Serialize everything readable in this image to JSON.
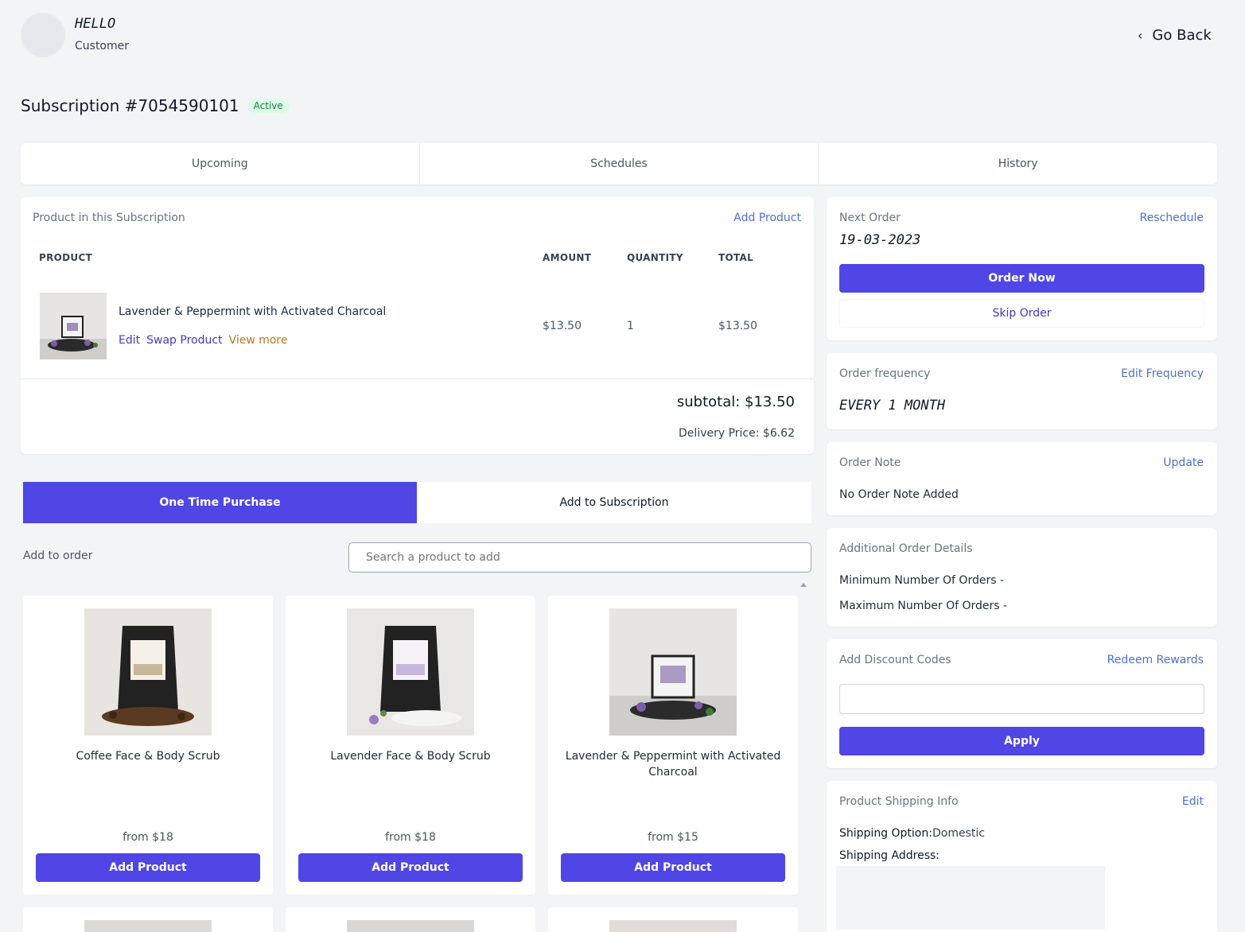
{
  "header": {
    "greeting": "HELLO",
    "user_role": "Customer",
    "go_back_label": "Go Back"
  },
  "subscription": {
    "title": "Subscription #7054590101",
    "status": "Active"
  },
  "tabs": [
    {
      "label": "Upcoming"
    },
    {
      "label": "Schedules"
    },
    {
      "label": "History"
    }
  ],
  "products_panel": {
    "title": "Product in this Subscription",
    "add_product_link": "Add Product",
    "columns": {
      "product": "PRODUCT",
      "amount": "AMOUNT",
      "quantity": "QUANTITY",
      "total": "TOTAL"
    },
    "item": {
      "name": "Lavender & Peppermint with Activated Charcoal",
      "edit": "Edit",
      "swap": "Swap Product",
      "view_more": "View more",
      "amount": "$13.50",
      "quantity": "1",
      "total": "$13.50"
    },
    "subtotal": "subtotal: $13.50",
    "delivery": "Delivery Price: $6.62"
  },
  "purchase_toggle": {
    "one_time": "One Time Purchase",
    "add_to_sub": "Add to Subscription"
  },
  "add_to_order": {
    "label": "Add to order",
    "search_placeholder": "Search a product to add"
  },
  "catalog": [
    {
      "name": "Coffee Face & Body Scrub",
      "price": "from $18",
      "button": "Add Product"
    },
    {
      "name": "Lavender Face & Body Scrub",
      "price": "from $18",
      "button": "Add Product"
    },
    {
      "name": "Lavender & Peppermint with Activated Charcoal",
      "price": "from $15",
      "button": "Add Product"
    }
  ],
  "next_order": {
    "label": "Next Order",
    "reschedule": "Reschedule",
    "date": "19-03-2023",
    "order_now": "Order Now",
    "skip": "Skip Order"
  },
  "frequency": {
    "label": "Order frequency",
    "edit": "Edit Frequency",
    "value": "EVERY 1 MONTH"
  },
  "order_note": {
    "label": "Order Note",
    "update": "Update",
    "value": "No Order Note Added"
  },
  "additional": {
    "label": "Additional Order Details",
    "min": "Minimum Number Of Orders -",
    "max": "Maximum Number Of Orders -"
  },
  "discount": {
    "label": "Add Discount Codes",
    "redeem": "Redeem Rewards",
    "apply": "Apply"
  },
  "shipping": {
    "label": "Product Shipping Info",
    "edit": "Edit",
    "option_label": "Shipping Option:",
    "option_value": "Domestic",
    "address_label": "Shipping Address:"
  },
  "colors": {
    "primary": "#4f46e5",
    "link": "#4f6fd6",
    "active_badge_bg": "#dcfce7",
    "active_badge_text": "#15803d",
    "view_more": "#b7791f"
  }
}
